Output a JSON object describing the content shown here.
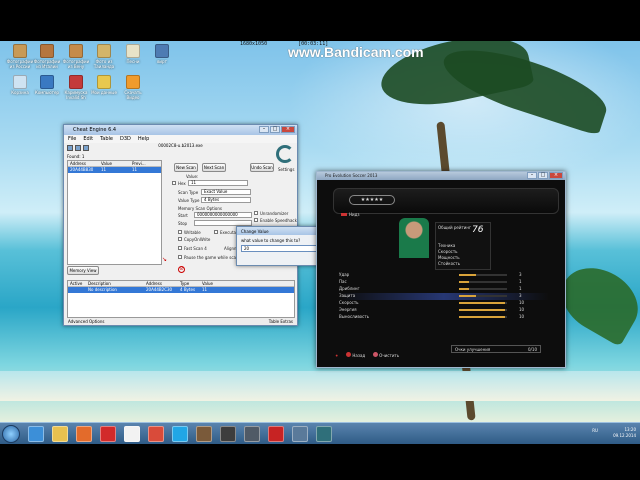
{
  "watermark": "www.Bandicam.com",
  "recorder": {
    "left_label": "1680x1050",
    "right_label": "[00:03:11]"
  },
  "desktop_icons": [
    {
      "label": "Фотографии из России",
      "name": "desktop-icon-photos-russia",
      "color": "#c89a56"
    },
    {
      "label": "Фотографии из Италии",
      "name": "desktop-icon-photos-italy",
      "color": "#b5763f"
    },
    {
      "label": "Фотографии из Вену",
      "name": "desktop-icon-photos-vienna",
      "color": "#c58b4a"
    },
    {
      "label": "Фото из Таиланда",
      "name": "desktop-icon-photos-thailand",
      "color": "#d3b56a"
    },
    {
      "label": "Песни",
      "name": "desktop-icon-songs",
      "color": "#e7e3c8"
    },
    {
      "label": "вирт",
      "name": "desktop-icon-virt",
      "color": "#4e7bb3"
    },
    {
      "label": "Корзина",
      "name": "desktop-icon-recycle-bin",
      "color": "#cfe3f2"
    },
    {
      "label": "Компьютер",
      "name": "desktop-icon-computer",
      "color": "#3a79c2"
    },
    {
      "label": "Каримуска Invalid Sh",
      "name": "desktop-icon-karimuska",
      "color": "#c43a3a"
    },
    {
      "label": "Мои данные",
      "name": "desktop-icon-my-data",
      "color": "#e8c84f"
    },
    {
      "label": "Скачать Видео",
      "name": "desktop-icon-download-video",
      "color": "#f09b2c"
    }
  ],
  "ce": {
    "title": "Cheat Engine 6.4",
    "menu": [
      "File",
      "Edit",
      "Table",
      "D3D",
      "Help"
    ],
    "process": "00002C8-u.b2013.exe",
    "found": "Found: 1",
    "results_headers": [
      "Address",
      "Value",
      "Previ..."
    ],
    "results_row": [
      "20A44B830",
      "11",
      "11"
    ],
    "new_scan": "New Scan",
    "next_scan": "Next Scan",
    "undo_scan": "Undo Scan",
    "settings": "Settings",
    "value_label": "Value:",
    "hex_label": "Hex",
    "value": "11",
    "scan_type_label": "Scan Type",
    "scan_type": "Exact Value",
    "value_type_label": "Value Type",
    "value_type": "4 Bytes",
    "mem_options": "Memory Scan Options",
    "start_label": "Start",
    "start_value": "0000000000000000",
    "stop_label": "Stop",
    "unrandomizer": "Unrandomizer",
    "speedhack": "Enable Speedhack",
    "writable": "Writable",
    "executable": "Executable",
    "copyonwrite": "CopyOnWrite",
    "fast_scan": "Fast Scan 4",
    "alignment": "Alignment",
    "pause_game": "Pause the game while scanning",
    "memory_view": "Memory View",
    "addr_headers": [
      "Active",
      "Description",
      "Address",
      "Type",
      "Value"
    ],
    "addr_row": [
      "",
      "No description",
      "20A44B2C30",
      "4 Bytes",
      "11"
    ],
    "advanced": "Advanced Options",
    "table_extras": "Table Extras"
  },
  "dialog": {
    "title": "Change Value",
    "prompt": "what value to change this to?",
    "input_value": "20",
    "ok": "OK",
    "cancel": "Cancel"
  },
  "game": {
    "title": "Pro Evolution Soccer 2013",
    "stars": "★★★★★",
    "badge": "Нидз",
    "overall_label": "Общий рейтинг",
    "overall_value": "76",
    "card_lines": [
      "Техника",
      "Скорость",
      "Мощность",
      "Стойкость"
    ],
    "stats": [
      {
        "name": "Удар",
        "value": "3",
        "level": 0.35
      },
      {
        "name": "Пас",
        "value": "1",
        "level": 0.2
      },
      {
        "name": "Дриблинг",
        "value": "1",
        "level": 0.2
      },
      {
        "name": "Защита",
        "value": "3",
        "level": 0.35,
        "selected": true
      },
      {
        "name": "Скорость",
        "value": "10",
        "level": 0.95
      },
      {
        "name": "Энергия",
        "value": "10",
        "level": 0.95
      },
      {
        "name": "Выносливость",
        "value": "10",
        "level": 0.95
      }
    ],
    "improve_label": "Очки улучшения",
    "improve_value": "0/10",
    "hint_back": "Назад",
    "hint_clear": "Очистить"
  },
  "taskbar": {
    "apps": [
      {
        "name": "taskbar-ie-icon",
        "color": "#3c8fd8"
      },
      {
        "name": "taskbar-explorer-icon",
        "color": "#e8c14f"
      },
      {
        "name": "taskbar-firefox-icon",
        "color": "#e36b2b"
      },
      {
        "name": "taskbar-opera-icon",
        "color": "#d22a2a"
      },
      {
        "name": "taskbar-yandex-icon",
        "color": "#f2f2f2"
      },
      {
        "name": "taskbar-media-icon",
        "color": "#d94b3a"
      },
      {
        "name": "taskbar-skype-icon",
        "color": "#21a6e6"
      },
      {
        "name": "taskbar-game-icon",
        "color": "#7a5a3a"
      },
      {
        "name": "taskbar-pes-icon",
        "color": "#3d3d3d"
      },
      {
        "name": "taskbar-video-icon",
        "color": "#505a66"
      },
      {
        "name": "taskbar-record-icon",
        "color": "#c72323"
      },
      {
        "name": "taskbar-photo-icon",
        "color": "#5a7a9a"
      },
      {
        "name": "taskbar-cheat-engine-icon",
        "color": "#2f6f7a"
      }
    ],
    "lang": "RU",
    "time": "13:20",
    "date": "09.12.2014"
  }
}
